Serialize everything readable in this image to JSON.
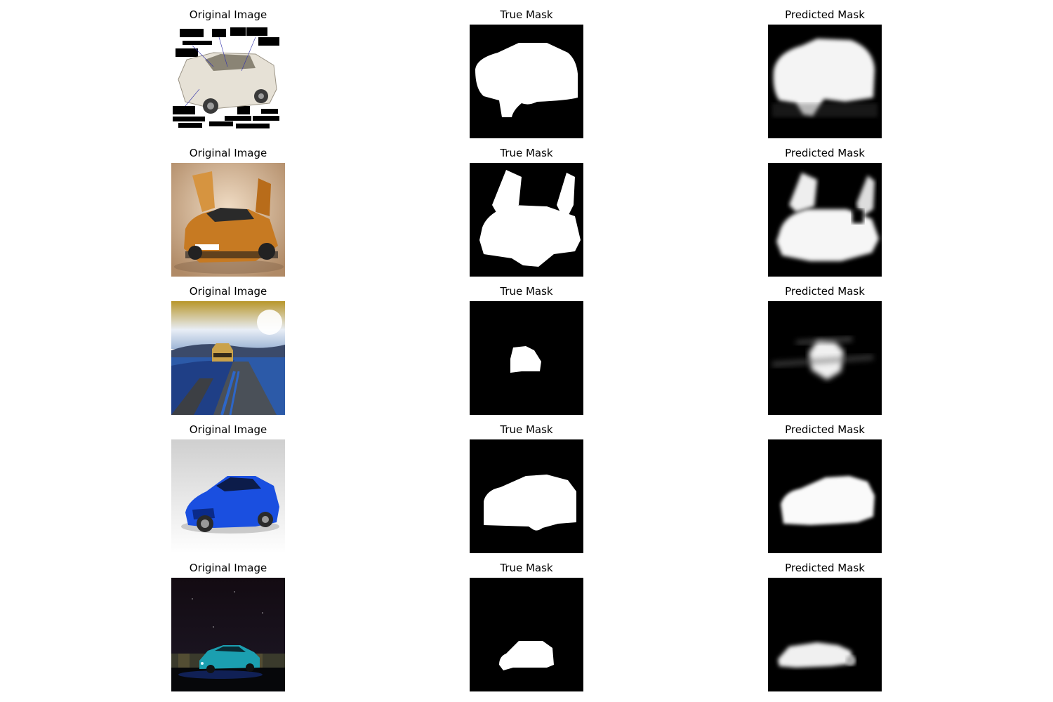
{
  "column_titles": {
    "original": "Original Image",
    "true_mask": "True Mask",
    "predicted_mask": "Predicted Mask"
  },
  "rows": [
    {
      "subject": "white SUV diagram with black callout labels"
    },
    {
      "subject": "orange sports car with open doors"
    },
    {
      "subject": "car on road under cloudy sky"
    },
    {
      "subject": "blue sports car on gray background"
    },
    {
      "subject": "teal car at night"
    }
  ]
}
